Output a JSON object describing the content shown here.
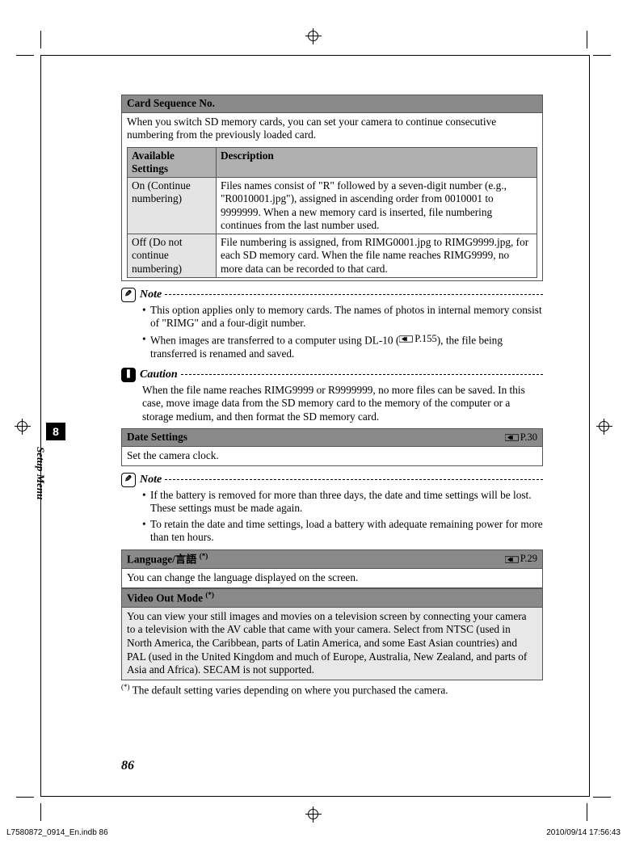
{
  "tab": {
    "number": "8",
    "label": "Setup Menu"
  },
  "page_number": "86",
  "footer": {
    "left": "L7580872_0914_En.indb   86",
    "right": "2010/09/14   17:56:43"
  },
  "card_seq": {
    "title": "Card Sequence No.",
    "intro": "When you switch SD memory cards, you can set your camera to continue consecutive numbering from the previously loaded card.",
    "col1": "Available Settings",
    "col2": "Description",
    "row1_setting": "On (Continue numbering)",
    "row1_desc": "Files names consist of \"R\" followed by a seven-digit number (e.g., \"R0010001.jpg\"), assigned in ascending order from 0010001 to 9999999. When a new memory card is inserted, file numbering continues from the last number used.",
    "row2_setting": "Off (Do not continue numbering)",
    "row2_desc": "File numbering is assigned, from RIMG0001.jpg to RIMG9999.jpg, for each SD memory card. When the file name reaches RIMG9999, no more data can be recorded to that card."
  },
  "note1": {
    "label": "Note",
    "b1": "This option applies only to memory cards. The names of photos in internal memory consist of \"RIMG\" and a four-digit number.",
    "b2a": "When images are transferred to a computer using DL-10 (",
    "b2_ref": "P.155",
    "b2b": "), the file being transferred is renamed and saved."
  },
  "caution": {
    "label": "Caution",
    "text": "When the file name reaches RIMG9999 or R9999999, no more files can be saved. In this case, move image data from the SD memory card to the memory of the computer or a storage medium, and then format the SD memory card."
  },
  "date": {
    "title": "Date Settings",
    "ref": "P.30",
    "body": "Set the camera clock."
  },
  "note2": {
    "label": "Note",
    "b1": "If the battery is removed for more than three days, the date and time settings will be lost. These settings must be made again.",
    "b2": "To retain the date and time settings, load a battery with adequate remaining power for more than ten hours."
  },
  "lang": {
    "title_en": "Language/",
    "title_jp": "言語",
    "star": "(*)",
    "ref": "P.29",
    "body": "You can change the language displayed on the screen."
  },
  "video": {
    "title": "Video Out Mode",
    "star": "(*)",
    "body": "You can view your still images and movies on a television screen by connecting your camera to a television with the AV cable that came with your camera. Select from NTSC (used in North America, the Caribbean, parts of Latin America, and some East Asian countries) and PAL (used in the United Kingdom and much of Europe, Australia, New Zealand, and parts of Asia and Africa). SECAM is not supported."
  },
  "default_note": {
    "star": "(*)",
    "text": " The default setting varies depending on where you purchased the camera."
  }
}
